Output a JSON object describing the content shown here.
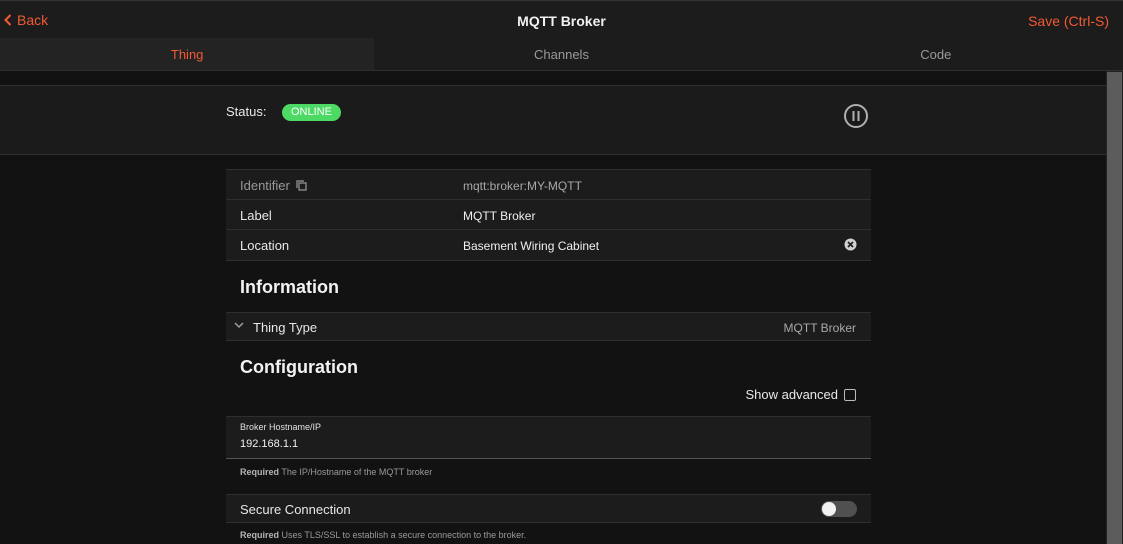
{
  "navbar": {
    "back_label": "Back",
    "title": "MQTT Broker",
    "save_label": "Save (Ctrl-S)"
  },
  "tabs": [
    {
      "label": "Thing",
      "active": true
    },
    {
      "label": "Channels",
      "active": false
    },
    {
      "label": "Code",
      "active": false
    }
  ],
  "status": {
    "label": "Status:",
    "value": "ONLINE",
    "badge_color": "#4cd964"
  },
  "properties": [
    {
      "key": "Identifier",
      "value": "mqtt:broker:MY-MQTT",
      "icon": "copy-icon"
    },
    {
      "key": "Label",
      "value": "MQTT Broker"
    },
    {
      "key": "Location",
      "value": "Basement Wiring Cabinet",
      "icon": "clear-icon"
    }
  ],
  "information": {
    "title": "Information",
    "thing_type_label": "Thing Type",
    "thing_type_value": "MQTT Broker"
  },
  "configuration": {
    "title": "Configuration",
    "show_advanced_label": "Show advanced",
    "show_advanced_checked": false,
    "broker": {
      "label": "Broker Hostname/IP",
      "value": "192.168.1.1",
      "required": "Required",
      "hint": " The IP/Hostname of the MQTT broker"
    },
    "secure": {
      "label": "Secure Connection",
      "enabled": false,
      "required": "Required",
      "hint": " Uses TLS/SSL to establish a secure connection to the broker."
    }
  },
  "colors": {
    "accent": "#f35a34",
    "background": "#121212",
    "surface": "#1c1c1c"
  }
}
